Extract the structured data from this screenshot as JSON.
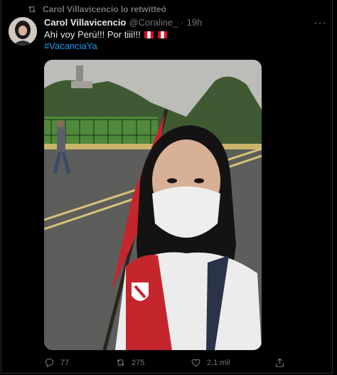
{
  "retweet": {
    "text": "Carol Villavicencio lo retwitteó"
  },
  "tweet": {
    "author_name": "Carol Villavicencio",
    "handle": "@Coraline_",
    "separator": "·",
    "time": "19h",
    "text": "Ahí voy Perú!!! Por tiii!!!",
    "hashtag": "#VacanciaYa",
    "flag_icons": [
      "peru-flag-icon",
      "peru-flag-icon"
    ]
  },
  "actions": {
    "replies": "77",
    "retweets": "275",
    "likes": "2,1 mil"
  },
  "colors": {
    "background": "#000000",
    "text": "#e7e9ea",
    "muted": "#71767b",
    "link": "#1d9bf0",
    "flag_red": "#d91023"
  }
}
